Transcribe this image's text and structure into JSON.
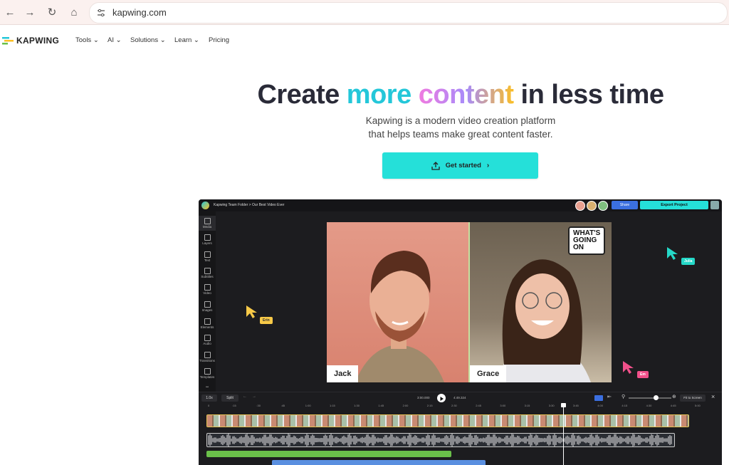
{
  "browser": {
    "url": "kapwing.com"
  },
  "site": {
    "brand": "KAPWING",
    "nav": [
      "Tools ⌄",
      "AI ⌄",
      "Solutions ⌄",
      "Learn ⌄",
      "Pricing"
    ]
  },
  "hero": {
    "title_a": "Create ",
    "title_b": "more ",
    "title_c": "content",
    "title_d": " in less time",
    "subtitle_1": "Kapwing is a modern video creation platform",
    "subtitle_2": "that helps teams make great content faster.",
    "cta": "Get started"
  },
  "editor": {
    "breadcrumb": "Kapwing Team Folder  >  Our Best Video Ever",
    "share": "Share",
    "export": "Export Project",
    "sidebar": [
      "Media",
      "Layers",
      "Text",
      "Subtitles",
      "Video",
      "Images",
      "Elements",
      "Audio",
      "Transitions",
      "Templates"
    ],
    "speaker_left": "Jack",
    "speaker_right": "Grace",
    "bubble": [
      "WHAT'S",
      "GOING",
      "ON"
    ],
    "cursors": {
      "erin": "Erin",
      "julia": "Julia",
      "em": "Em"
    },
    "speed": "1.0x",
    "split": "Split",
    "time_current": "3:00.000",
    "time_total": "4:49.324",
    "fit": "Fit to Screen",
    "ruler": [
      "0",
      ":15",
      ":30",
      ":45",
      "1:00",
      "1:15",
      "1:30",
      "1:45",
      "2:00",
      "2:15",
      "2:30",
      "2:45",
      "3:00",
      "3:15",
      "3:30",
      "3:45",
      "4:00",
      "4:15",
      "4:30",
      "4:45",
      "5:00"
    ]
  },
  "colors": {
    "accent": "#25e0d9",
    "cyan": "#24c7d9",
    "editor_bg": "#1c1c1f",
    "audio_green": "#6ac04a",
    "audio_blue": "#5a8fe0"
  }
}
